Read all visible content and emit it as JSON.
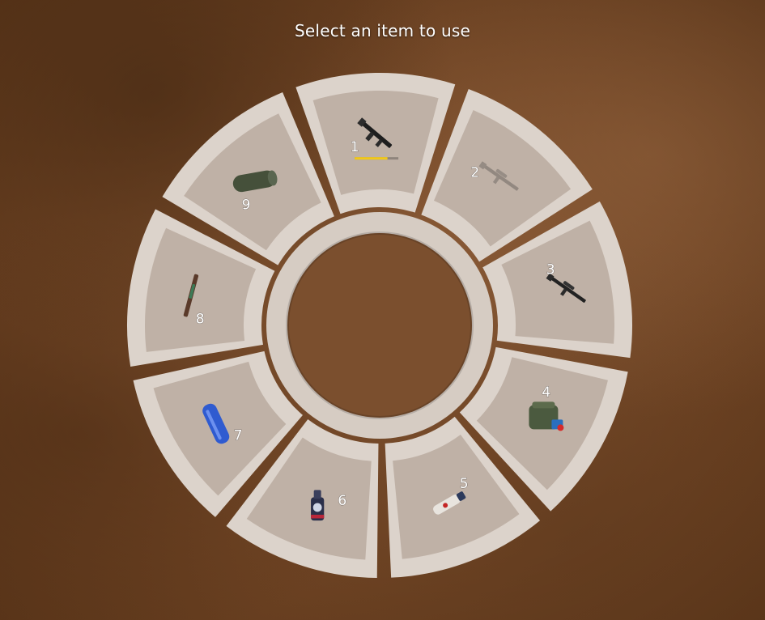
{
  "header": {
    "prompt": "Select an item to use"
  },
  "colors": {
    "segment_outer": "#dcd3cb",
    "segment_inner": "#bfb1a6",
    "center_ring": "#d6ccc3",
    "ammo_bar": "#f2c81a"
  },
  "slots": [
    {
      "number": "1",
      "icon": "assault-rifle-icon",
      "equipped": true,
      "ammo_fill": 0.75
    },
    {
      "number": "2",
      "icon": "sniper-rifle-icon",
      "equipped": false,
      "faded": true
    },
    {
      "number": "3",
      "icon": "sniper-rifle-icon",
      "equipped": false
    },
    {
      "number": "4",
      "icon": "backpack-medkit-icon",
      "equipped": false
    },
    {
      "number": "5",
      "icon": "spray-can-icon",
      "equipped": false
    },
    {
      "number": "6",
      "icon": "drink-bottle-icon",
      "equipped": false
    },
    {
      "number": "7",
      "icon": "blue-canister-icon",
      "equipped": false
    },
    {
      "number": "8",
      "icon": "syringe-stick-icon",
      "equipped": false
    },
    {
      "number": "9",
      "icon": "sleeping-bag-icon",
      "equipped": false
    }
  ]
}
